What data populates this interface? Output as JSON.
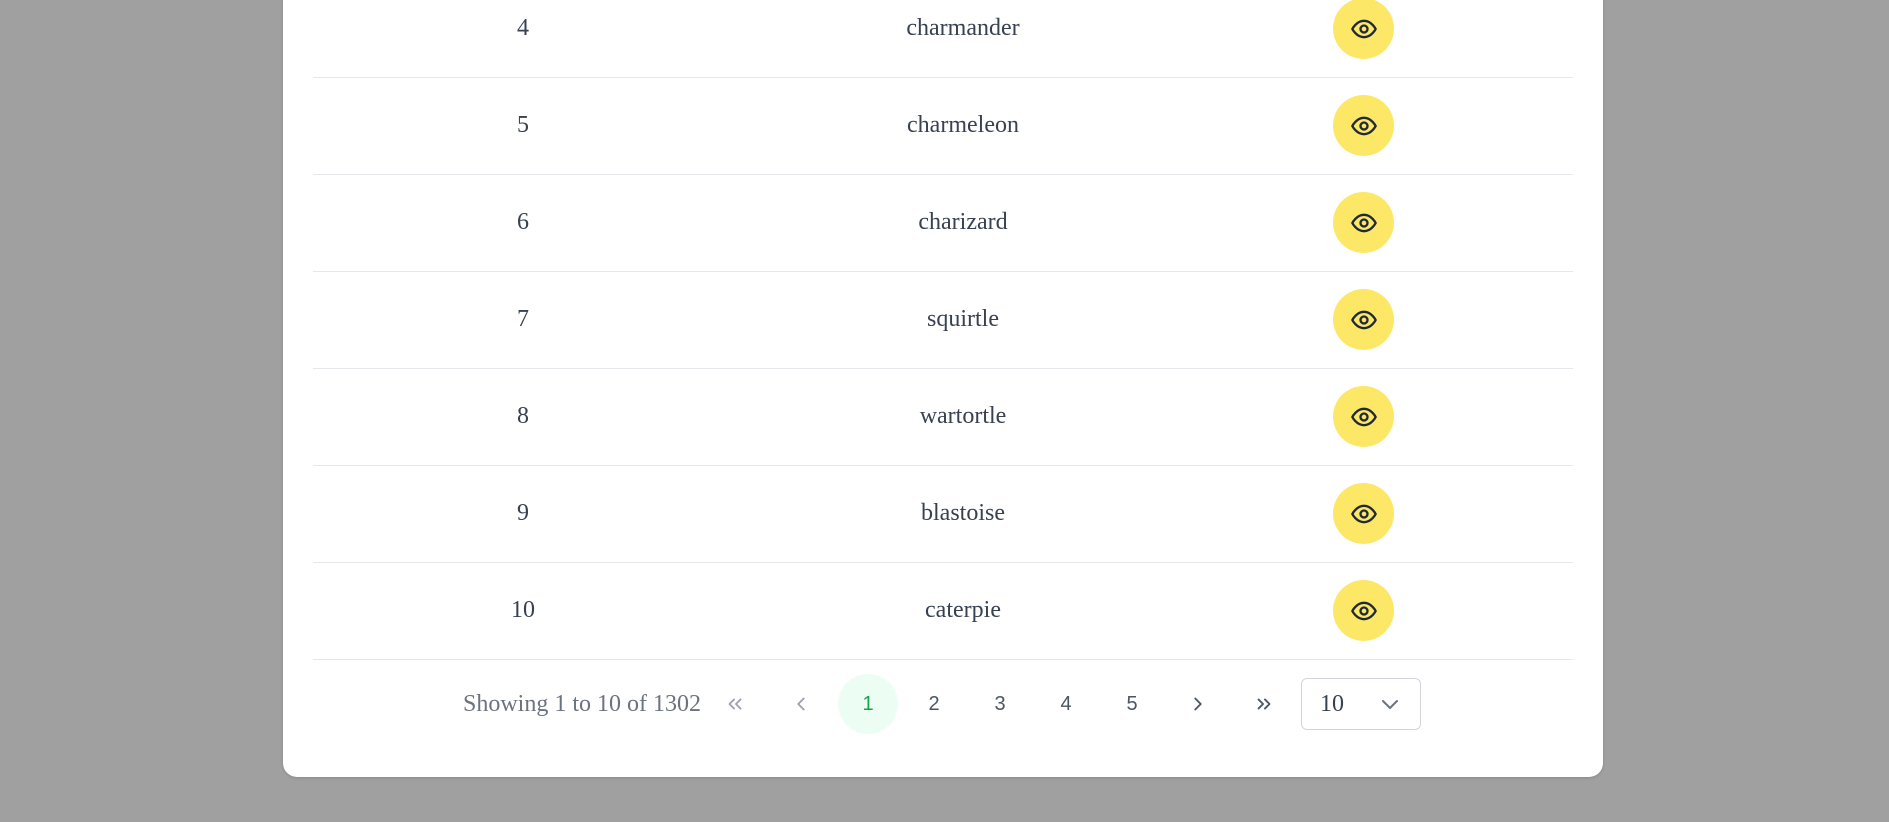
{
  "table": {
    "rows": [
      {
        "id": "4",
        "name": "charmander"
      },
      {
        "id": "5",
        "name": "charmeleon"
      },
      {
        "id": "6",
        "name": "charizard"
      },
      {
        "id": "7",
        "name": "squirtle"
      },
      {
        "id": "8",
        "name": "wartortle"
      },
      {
        "id": "9",
        "name": "blastoise"
      },
      {
        "id": "10",
        "name": "caterpie"
      }
    ],
    "row_action_icon": "eye-icon",
    "action_color": "#fde767"
  },
  "pagination": {
    "summary": "Showing 1 to 10 of 1302",
    "first_icon": "double-chevron-left-icon",
    "prev_icon": "chevron-left-icon",
    "pages": [
      "1",
      "2",
      "3",
      "4",
      "5"
    ],
    "current_page": "1",
    "next_icon": "chevron-right-icon",
    "last_icon": "double-chevron-right-icon",
    "page_size": "10",
    "active_color": "#16a34a"
  }
}
